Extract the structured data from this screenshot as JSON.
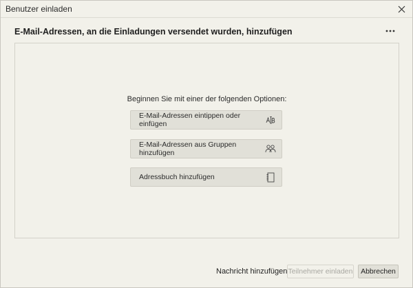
{
  "dialog": {
    "title": "Benutzer einladen",
    "heading": "E-Mail-Adressen, an die Einladungen versendet wurden, hinzufügen",
    "prompt": "Beginnen Sie mit einer der folgenden Optionen:",
    "options": [
      {
        "label": "E-Mail-Adressen eintippen oder einfügen",
        "icon": "text-cursor-icon"
      },
      {
        "label": "E-Mail-Adressen aus Gruppen hinzufügen",
        "icon": "people-group-icon"
      },
      {
        "label": "Adressbuch hinzufügen",
        "icon": "address-book-icon"
      }
    ]
  },
  "footer": {
    "add_message": "Nachricht hinzufügen",
    "invite_label": "Teilnehmer einladen",
    "cancel_label": "Abbrechen"
  },
  "colors": {
    "background": "#f2f1ea",
    "option_button": "#e1e0d8",
    "disabled_text": "#a8a7a1"
  }
}
